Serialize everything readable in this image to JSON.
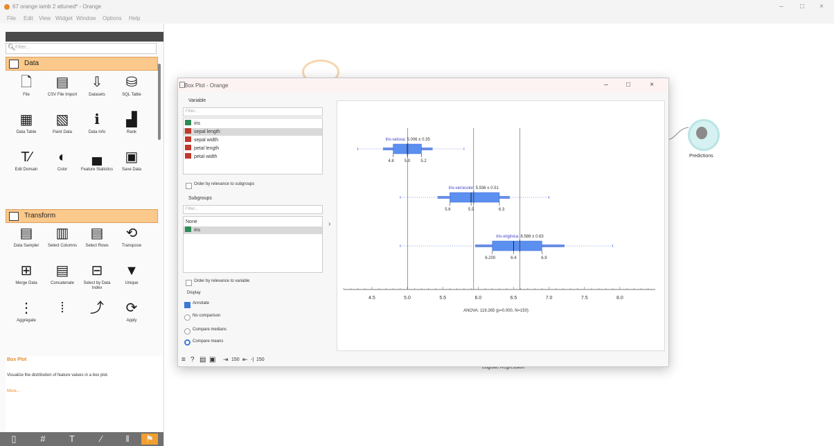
{
  "window": {
    "title": "67 orange iamb 2 attuned* - Orange",
    "menu": [
      "File",
      "Edit",
      "View",
      "Widget",
      "Window",
      "Options",
      "Help"
    ],
    "controls": {
      "minimize": "–",
      "maximize": "□",
      "close": "×"
    }
  },
  "left_panel": {
    "filter_placeholder": "Filter...",
    "categories": [
      {
        "name": "Data",
        "color": "#fbc98b"
      },
      {
        "name": "Transform",
        "color": "#fbc98b"
      }
    ],
    "data_widgets": [
      {
        "label": "File",
        "icon": "file-icon",
        "glyph": "🗋"
      },
      {
        "label": "CSV File Import",
        "icon": "csv-icon",
        "glyph": "▤"
      },
      {
        "label": "Datasets",
        "icon": "datasets-icon",
        "glyph": "⇩"
      },
      {
        "label": "SQL Table",
        "icon": "sql-table-icon",
        "glyph": "⛁"
      },
      {
        "label": "Data Table",
        "icon": "data-table-icon",
        "glyph": "▦"
      },
      {
        "label": "Paint Data",
        "icon": "paint-data-icon",
        "glyph": "▧"
      },
      {
        "label": "Data Info",
        "icon": "data-info-icon",
        "glyph": "ℹ"
      },
      {
        "label": "Rank",
        "icon": "rank-icon",
        "glyph": "▟"
      },
      {
        "label": "Edit Domain",
        "icon": "edit-domain-icon",
        "glyph": "T⁄"
      },
      {
        "label": "Color",
        "icon": "color-icon",
        "glyph": "◐"
      },
      {
        "label": "Feature Statistics",
        "icon": "feature-statistics-icon",
        "glyph": "▄"
      },
      {
        "label": "Save Data",
        "icon": "save-data-icon",
        "glyph": "▣"
      }
    ],
    "transform_widgets": [
      {
        "label": "Data Sampler",
        "icon": "data-sampler-icon",
        "glyph": "▤"
      },
      {
        "label": "Select Columns",
        "icon": "select-columns-icon",
        "glyph": "▥"
      },
      {
        "label": "Select Rows",
        "icon": "select-rows-icon",
        "glyph": "▤"
      },
      {
        "label": "Transpose",
        "icon": "transpose-icon",
        "glyph": "⟲"
      },
      {
        "label": "Merge Data",
        "icon": "merge-data-icon",
        "glyph": "⊞"
      },
      {
        "label": "Concatenate",
        "icon": "concatenate-icon",
        "glyph": "▤"
      },
      {
        "label": "Select by Data Index",
        "icon": "select-by-index-icon",
        "glyph": "⊟"
      },
      {
        "label": "Unique",
        "icon": "unique-icon",
        "glyph": "▼"
      },
      {
        "label": "Aggregate",
        "icon": "aggregate-icon",
        "glyph": "⋮"
      },
      {
        "label": "",
        "icon": "group-by-icon",
        "glyph": "⁞"
      },
      {
        "label": "",
        "icon": "formula-icon",
        "glyph": "⤴"
      },
      {
        "label": "Apply",
        "icon": "apply-icon",
        "glyph": "⟳"
      }
    ],
    "description": {
      "title": "Box Plot",
      "text": "Visualize the distribution of feature values in a box plot.",
      "more": "More..."
    },
    "bottom_toolbar": [
      "▯",
      "#",
      "T",
      "⁄",
      "‖",
      "⚑"
    ]
  },
  "canvas": {
    "predictions_label": "Predictions",
    "lr_label": "Logistic Regression"
  },
  "dialog": {
    "title": "Box Plot - Orange",
    "variable_label": "Variable",
    "variable_filter": "Filter...",
    "variables": [
      {
        "name": "iris",
        "color": "#2e8b57",
        "selected": false
      },
      {
        "name": "sepal length",
        "color": "#c0392b",
        "selected": true
      },
      {
        "name": "sepal width",
        "color": "#c0392b",
        "selected": false
      },
      {
        "name": "petal length",
        "color": "#c0392b",
        "selected": false
      },
      {
        "name": "petal width",
        "color": "#c0392b",
        "selected": false
      }
    ],
    "order_subgroups": "Order by relevance to subgroups",
    "subgroups_label": "Subgroups",
    "subgroups_filter": "Filter...",
    "subgroups": [
      {
        "name": "None",
        "selected": false
      },
      {
        "name": "iris",
        "color": "#2e8b57",
        "selected": true
      }
    ],
    "order_variable": "Order by relevance to variable",
    "display_label": "Display",
    "options": {
      "annotate": "Annotate",
      "no_comparison": "No comparison",
      "compare_medians": "Compare medians",
      "compare_means": "Compare means"
    },
    "status": {
      "in_count": "150",
      "out_count": "150"
    }
  },
  "chart_data": {
    "type": "box",
    "axis_ticks": [
      4.5,
      5.0,
      5.5,
      6.0,
      6.5,
      7.0,
      7.5,
      8.0
    ],
    "xlim": [
      4.1,
      8.5
    ],
    "footer": "ANOVA: 119.265 (p=0.000, N=150)",
    "series": [
      {
        "name": "Iris-setosa",
        "mean_label": "5.006 ± 0.35",
        "min": 4.3,
        "q1": 4.8,
        "median": 5.0,
        "q3": 5.2,
        "max": 5.8,
        "mean": 5.006,
        "sd": 0.35,
        "ticks": [
          "4.8",
          "5.0",
          "5.2"
        ]
      },
      {
        "name": "Iris-versicolor",
        "mean_label": "5.936 ± 0.51",
        "min": 4.9,
        "q1": 5.6,
        "median": 5.9,
        "q3": 6.3,
        "max": 7.0,
        "mean": 5.936,
        "sd": 0.51,
        "ticks": [
          "5.6",
          "5.9",
          "6.3"
        ]
      },
      {
        "name": "Iris-virginica",
        "mean_label": "6.588 ± 0.63",
        "min": 4.9,
        "q1": 6.2,
        "median": 6.5,
        "q3": 6.9,
        "max": 7.9,
        "mean": 6.588,
        "sd": 0.63,
        "ticks": [
          "6.200",
          "6.4",
          "6.9"
        ]
      }
    ]
  }
}
